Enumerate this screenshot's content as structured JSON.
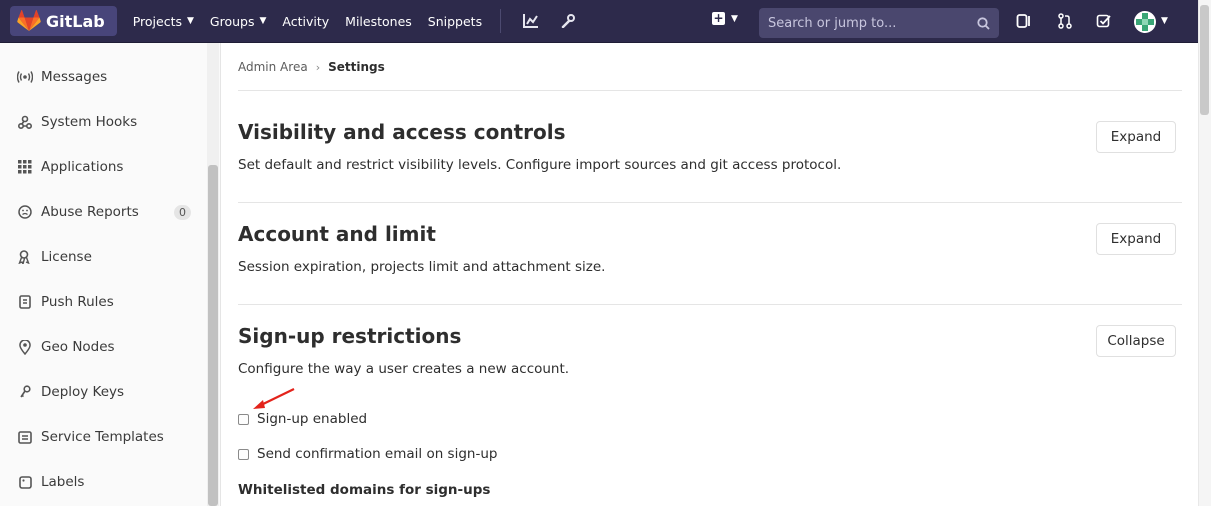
{
  "brand": {
    "name": "GitLab"
  },
  "nav": {
    "projects": "Projects",
    "groups": "Groups",
    "activity": "Activity",
    "milestones": "Milestones",
    "snippets": "Snippets"
  },
  "search": {
    "placeholder": "Search or jump to..."
  },
  "sidebar": {
    "items": [
      {
        "label": "Messages",
        "icon": "broadcast-icon"
      },
      {
        "label": "System Hooks",
        "icon": "hook-icon"
      },
      {
        "label": "Applications",
        "icon": "grid-icon"
      },
      {
        "label": "Abuse Reports",
        "icon": "smiley-icon",
        "badge": "0"
      },
      {
        "label": "License",
        "icon": "certificate-icon"
      },
      {
        "label": "Push Rules",
        "icon": "push-rules-icon"
      },
      {
        "label": "Geo Nodes",
        "icon": "location-icon"
      },
      {
        "label": "Deploy Keys",
        "icon": "key-icon"
      },
      {
        "label": "Service Templates",
        "icon": "template-icon"
      },
      {
        "label": "Labels",
        "icon": "label-icon"
      }
    ]
  },
  "breadcrumb": {
    "parent": "Admin Area",
    "current": "Settings"
  },
  "sections": [
    {
      "title": "Visibility and access controls",
      "description": "Set default and restrict visibility levels. Configure import sources and git access protocol.",
      "button": "Expand"
    },
    {
      "title": "Account and limit",
      "description": "Session expiration, projects limit and attachment size.",
      "button": "Expand"
    },
    {
      "title": "Sign-up restrictions",
      "description": "Configure the way a user creates a new account.",
      "button": "Collapse"
    }
  ],
  "signup": {
    "signup_enabled": "Sign-up enabled",
    "send_confirmation": "Send confirmation email on sign-up",
    "whitelist_label": "Whitelisted domains for sign-ups"
  },
  "colors": {
    "navbar": "#2d2a4b",
    "annotation_arrow": "#e3231b"
  }
}
